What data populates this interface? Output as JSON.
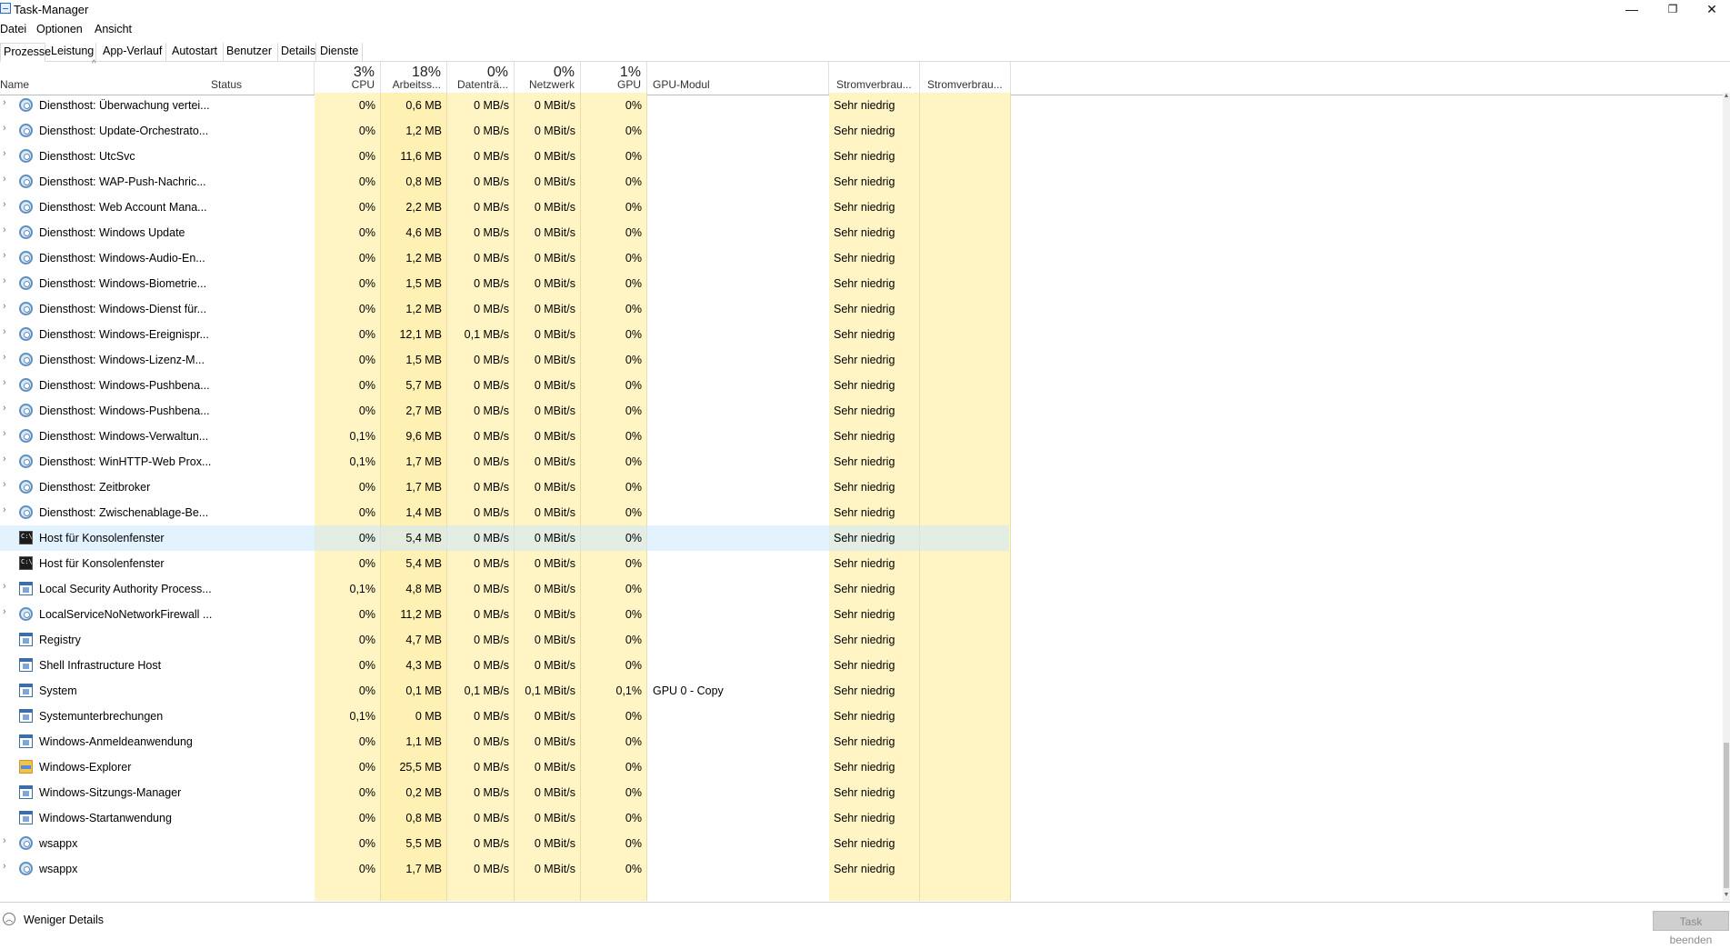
{
  "window": {
    "title": "Task-Manager",
    "controls": {
      "minimize": "—",
      "maximize": "❐",
      "close": "✕"
    }
  },
  "menu": [
    "Datei",
    "Optionen",
    "Ansicht"
  ],
  "tabs": [
    "Prozesse",
    "Leistung",
    "App-Verlauf",
    "Autostart",
    "Benutzer",
    "Details",
    "Dienste"
  ],
  "active_tab": "Prozesse",
  "columns": {
    "name": "Name",
    "status": "Status",
    "cpu": {
      "pct": "3%",
      "label": "CPU"
    },
    "mem": {
      "pct": "18%",
      "label": "Arbeitss..."
    },
    "disk": {
      "pct": "0%",
      "label": "Datenträ..."
    },
    "net": {
      "pct": "0%",
      "label": "Netzwerk"
    },
    "gpu": {
      "pct": "1%",
      "label": "GPU"
    },
    "gpu_engine": "GPU-Modul",
    "power": "Stromverbrau...",
    "power_trend": "Stromverbrau..."
  },
  "rows": [
    {
      "expand": true,
      "icon": "gear-icon",
      "name": "Diensthost: Überwachung vertei...",
      "cpu": "0%",
      "mem": "0,6 MB",
      "disk": "0 MB/s",
      "net": "0 MBit/s",
      "gpu": "0%",
      "gpu_engine": "",
      "power": "Sehr niedrig",
      "power_trend": ""
    },
    {
      "expand": true,
      "icon": "gear-icon",
      "name": "Diensthost: Update-Orchestrato...",
      "cpu": "0%",
      "mem": "1,2 MB",
      "disk": "0 MB/s",
      "net": "0 MBit/s",
      "gpu": "0%",
      "gpu_engine": "",
      "power": "Sehr niedrig",
      "power_trend": ""
    },
    {
      "expand": true,
      "icon": "gear-icon",
      "name": "Diensthost: UtcSvc",
      "cpu": "0%",
      "mem": "11,6 MB",
      "disk": "0 MB/s",
      "net": "0 MBit/s",
      "gpu": "0%",
      "gpu_engine": "",
      "power": "Sehr niedrig",
      "power_trend": ""
    },
    {
      "expand": true,
      "icon": "gear-icon",
      "name": "Diensthost: WAP-Push-Nachric...",
      "cpu": "0%",
      "mem": "0,8 MB",
      "disk": "0 MB/s",
      "net": "0 MBit/s",
      "gpu": "0%",
      "gpu_engine": "",
      "power": "Sehr niedrig",
      "power_trend": ""
    },
    {
      "expand": true,
      "icon": "gear-icon",
      "name": "Diensthost: Web Account Mana...",
      "cpu": "0%",
      "mem": "2,2 MB",
      "disk": "0 MB/s",
      "net": "0 MBit/s",
      "gpu": "0%",
      "gpu_engine": "",
      "power": "Sehr niedrig",
      "power_trend": ""
    },
    {
      "expand": true,
      "icon": "gear-icon",
      "name": "Diensthost: Windows Update",
      "cpu": "0%",
      "mem": "4,6 MB",
      "disk": "0 MB/s",
      "net": "0 MBit/s",
      "gpu": "0%",
      "gpu_engine": "",
      "power": "Sehr niedrig",
      "power_trend": ""
    },
    {
      "expand": true,
      "icon": "gear-icon",
      "name": "Diensthost: Windows-Audio-En...",
      "cpu": "0%",
      "mem": "1,2 MB",
      "disk": "0 MB/s",
      "net": "0 MBit/s",
      "gpu": "0%",
      "gpu_engine": "",
      "power": "Sehr niedrig",
      "power_trend": ""
    },
    {
      "expand": true,
      "icon": "gear-icon",
      "name": "Diensthost: Windows-Biometrie...",
      "cpu": "0%",
      "mem": "1,5 MB",
      "disk": "0 MB/s",
      "net": "0 MBit/s",
      "gpu": "0%",
      "gpu_engine": "",
      "power": "Sehr niedrig",
      "power_trend": ""
    },
    {
      "expand": true,
      "icon": "gear-icon",
      "name": "Diensthost: Windows-Dienst für...",
      "cpu": "0%",
      "mem": "1,2 MB",
      "disk": "0 MB/s",
      "net": "0 MBit/s",
      "gpu": "0%",
      "gpu_engine": "",
      "power": "Sehr niedrig",
      "power_trend": ""
    },
    {
      "expand": true,
      "icon": "gear-icon",
      "name": "Diensthost: Windows-Ereignispr...",
      "cpu": "0%",
      "mem": "12,1 MB",
      "disk": "0,1 MB/s",
      "net": "0 MBit/s",
      "gpu": "0%",
      "gpu_engine": "",
      "power": "Sehr niedrig",
      "power_trend": ""
    },
    {
      "expand": true,
      "icon": "gear-icon",
      "name": "Diensthost: Windows-Lizenz-M...",
      "cpu": "0%",
      "mem": "1,5 MB",
      "disk": "0 MB/s",
      "net": "0 MBit/s",
      "gpu": "0%",
      "gpu_engine": "",
      "power": "Sehr niedrig",
      "power_trend": ""
    },
    {
      "expand": true,
      "icon": "gear-icon",
      "name": "Diensthost: Windows-Pushbena...",
      "cpu": "0%",
      "mem": "5,7 MB",
      "disk": "0 MB/s",
      "net": "0 MBit/s",
      "gpu": "0%",
      "gpu_engine": "",
      "power": "Sehr niedrig",
      "power_trend": ""
    },
    {
      "expand": true,
      "icon": "gear-icon",
      "name": "Diensthost: Windows-Pushbena...",
      "cpu": "0%",
      "mem": "2,7 MB",
      "disk": "0 MB/s",
      "net": "0 MBit/s",
      "gpu": "0%",
      "gpu_engine": "",
      "power": "Sehr niedrig",
      "power_trend": ""
    },
    {
      "expand": true,
      "icon": "gear-icon",
      "name": "Diensthost: Windows-Verwaltun...",
      "cpu": "0,1%",
      "mem": "9,6 MB",
      "disk": "0 MB/s",
      "net": "0 MBit/s",
      "gpu": "0%",
      "gpu_engine": "",
      "power": "Sehr niedrig",
      "power_trend": ""
    },
    {
      "expand": true,
      "icon": "gear-icon",
      "name": "Diensthost: WinHTTP-Web Prox...",
      "cpu": "0,1%",
      "mem": "1,7 MB",
      "disk": "0 MB/s",
      "net": "0 MBit/s",
      "gpu": "0%",
      "gpu_engine": "",
      "power": "Sehr niedrig",
      "power_trend": ""
    },
    {
      "expand": true,
      "icon": "gear-icon",
      "name": "Diensthost: Zeitbroker",
      "cpu": "0%",
      "mem": "1,7 MB",
      "disk": "0 MB/s",
      "net": "0 MBit/s",
      "gpu": "0%",
      "gpu_engine": "",
      "power": "Sehr niedrig",
      "power_trend": ""
    },
    {
      "expand": true,
      "icon": "gear-icon",
      "name": "Diensthost: Zwischenablage-Be...",
      "cpu": "0%",
      "mem": "1,4 MB",
      "disk": "0 MB/s",
      "net": "0 MBit/s",
      "gpu": "0%",
      "gpu_engine": "",
      "power": "Sehr niedrig",
      "power_trend": ""
    },
    {
      "expand": false,
      "icon": "console-icon",
      "name": "Host für Konsolenfenster",
      "cpu": "0%",
      "mem": "5,4 MB",
      "disk": "0 MB/s",
      "net": "0 MBit/s",
      "gpu": "0%",
      "gpu_engine": "",
      "power": "Sehr niedrig",
      "power_trend": "",
      "selected": true
    },
    {
      "expand": false,
      "icon": "console-icon",
      "name": "Host für Konsolenfenster",
      "cpu": "0%",
      "mem": "5,4 MB",
      "disk": "0 MB/s",
      "net": "0 MBit/s",
      "gpu": "0%",
      "gpu_engine": "",
      "power": "Sehr niedrig",
      "power_trend": ""
    },
    {
      "expand": true,
      "icon": "window-icon",
      "name": "Local Security Authority Process...",
      "cpu": "0,1%",
      "mem": "4,8 MB",
      "disk": "0 MB/s",
      "net": "0 MBit/s",
      "gpu": "0%",
      "gpu_engine": "",
      "power": "Sehr niedrig",
      "power_trend": ""
    },
    {
      "expand": true,
      "icon": "gear-icon",
      "name": "LocalServiceNoNetworkFirewall ...",
      "cpu": "0%",
      "mem": "11,2 MB",
      "disk": "0 MB/s",
      "net": "0 MBit/s",
      "gpu": "0%",
      "gpu_engine": "",
      "power": "Sehr niedrig",
      "power_trend": ""
    },
    {
      "expand": false,
      "icon": "window-icon",
      "name": "Registry",
      "cpu": "0%",
      "mem": "4,7 MB",
      "disk": "0 MB/s",
      "net": "0 MBit/s",
      "gpu": "0%",
      "gpu_engine": "",
      "power": "Sehr niedrig",
      "power_trend": ""
    },
    {
      "expand": false,
      "icon": "window-icon",
      "name": "Shell Infrastructure Host",
      "cpu": "0%",
      "mem": "4,3 MB",
      "disk": "0 MB/s",
      "net": "0 MBit/s",
      "gpu": "0%",
      "gpu_engine": "",
      "power": "Sehr niedrig",
      "power_trend": ""
    },
    {
      "expand": false,
      "icon": "window-icon",
      "name": "System",
      "cpu": "0%",
      "mem": "0,1 MB",
      "disk": "0,1 MB/s",
      "net": "0,1 MBit/s",
      "gpu": "0,1%",
      "gpu_engine": "GPU 0 - Copy",
      "power": "Sehr niedrig",
      "power_trend": ""
    },
    {
      "expand": false,
      "icon": "window-icon",
      "name": "Systemunterbrechungen",
      "cpu": "0,1%",
      "mem": "0 MB",
      "disk": "0 MB/s",
      "net": "0 MBit/s",
      "gpu": "0%",
      "gpu_engine": "",
      "power": "Sehr niedrig",
      "power_trend": ""
    },
    {
      "expand": false,
      "icon": "window-icon",
      "name": "Windows-Anmeldeanwendung",
      "cpu": "0%",
      "mem": "1,1 MB",
      "disk": "0 MB/s",
      "net": "0 MBit/s",
      "gpu": "0%",
      "gpu_engine": "",
      "power": "Sehr niedrig",
      "power_trend": ""
    },
    {
      "expand": false,
      "icon": "folder-icon",
      "name": "Windows-Explorer",
      "cpu": "0%",
      "mem": "25,5 MB",
      "disk": "0 MB/s",
      "net": "0 MBit/s",
      "gpu": "0%",
      "gpu_engine": "",
      "power": "Sehr niedrig",
      "power_trend": ""
    },
    {
      "expand": false,
      "icon": "window-icon",
      "name": "Windows-Sitzungs-Manager",
      "cpu": "0%",
      "mem": "0,2 MB",
      "disk": "0 MB/s",
      "net": "0 MBit/s",
      "gpu": "0%",
      "gpu_engine": "",
      "power": "Sehr niedrig",
      "power_trend": ""
    },
    {
      "expand": false,
      "icon": "window-icon",
      "name": "Windows-Startanwendung",
      "cpu": "0%",
      "mem": "0,8 MB",
      "disk": "0 MB/s",
      "net": "0 MBit/s",
      "gpu": "0%",
      "gpu_engine": "",
      "power": "Sehr niedrig",
      "power_trend": ""
    },
    {
      "expand": true,
      "icon": "gear-icon",
      "name": "wsappx",
      "cpu": "0%",
      "mem": "5,5 MB",
      "disk": "0 MB/s",
      "net": "0 MBit/s",
      "gpu": "0%",
      "gpu_engine": "",
      "power": "Sehr niedrig",
      "power_trend": ""
    },
    {
      "expand": true,
      "icon": "gear-icon",
      "name": "wsappx",
      "cpu": "0%",
      "mem": "1,7 MB",
      "disk": "0 MB/s",
      "net": "0 MBit/s",
      "gpu": "0%",
      "gpu_engine": "",
      "power": "Sehr niedrig",
      "power_trend": ""
    }
  ],
  "footer": {
    "fewer_details": "Weniger Details",
    "end_task": "Task beenden"
  },
  "colors": {
    "heat_light": "#fff4c4",
    "heat_mid": "#fff0b3",
    "selection": "#cce8ff"
  }
}
